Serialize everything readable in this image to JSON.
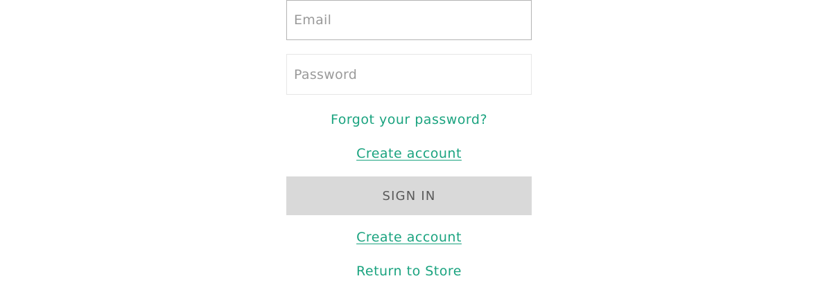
{
  "login_form": {
    "email_placeholder": "Email",
    "email_value": "",
    "password_placeholder": "Password",
    "password_value": "",
    "forgot_password_label": "Forgot your password?",
    "create_account_label": "Create account",
    "sign_in_label": "SIGN IN",
    "create_account_label_2": "Create account",
    "return_to_store_label": "Return to Store"
  },
  "colors": {
    "link": "#1aa37f",
    "button_bg": "#d9d9d9",
    "button_text": "#595959",
    "input_border": "#e6e6e6",
    "input_border_focused": "#b3b3b3",
    "placeholder": "#9a9a9a"
  }
}
